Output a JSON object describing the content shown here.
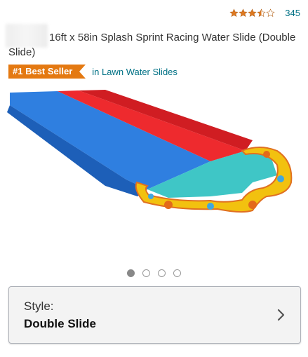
{
  "rating": {
    "stars": 3.5,
    "count": "345"
  },
  "product": {
    "title": "16ft x 58in Splash Sprint Racing Water Slide (Double Slide)"
  },
  "badge": {
    "label": "#1 Best Seller",
    "category": "in Lawn Water Slides"
  },
  "carousel": {
    "total": 4,
    "active": 0
  },
  "style_selector": {
    "label": "Style:",
    "value": "Double Slide"
  },
  "colors": {
    "badge_orange": "#e47911",
    "link_teal": "#007185",
    "star_orange": "#de7921",
    "slide_blue": "#2f7fe0",
    "slide_red": "#ee2a2e",
    "pool_teal": "#3fc6c6",
    "border_yellow": "#f2c10f"
  },
  "icons": {
    "star": "star-icon",
    "chevron": "chevron-right-icon",
    "image": "water-slide-image"
  }
}
